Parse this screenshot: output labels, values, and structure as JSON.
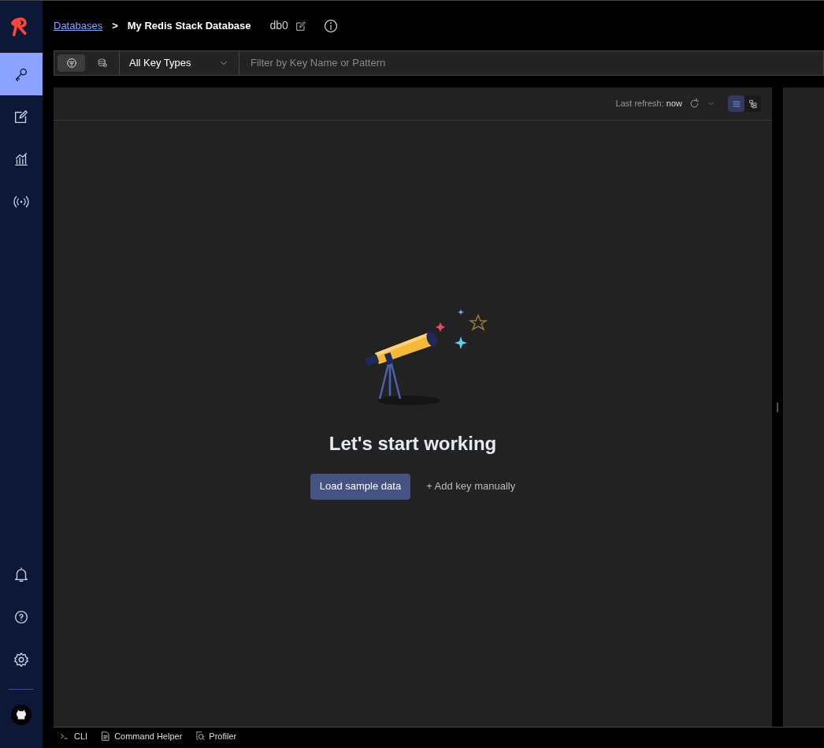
{
  "sidebar": {
    "nav_items": [
      {
        "kind": "key",
        "selected": true
      },
      {
        "kind": "edit",
        "selected": false
      },
      {
        "kind": "analytics",
        "selected": false
      },
      {
        "kind": "pubsub",
        "selected": false
      }
    ],
    "bottom_items": [
      {
        "kind": "bell"
      },
      {
        "kind": "help"
      },
      {
        "kind": "settings"
      },
      {
        "kind": "github"
      }
    ]
  },
  "breadcrumb": {
    "link": "Databases",
    "separator": ">",
    "current": "My Redis Stack Database",
    "db": "db0"
  },
  "filter_bar": {
    "modes": [
      {
        "kind": "filter",
        "selected": true
      },
      {
        "kind": "search",
        "selected": false
      }
    ],
    "key_type": "All Key Types",
    "search": {
      "placeholder": "Filter by Key Name or Pattern"
    }
  },
  "toolbar": {
    "last_refresh_label": "Last refresh:",
    "last_refresh_value": "now",
    "views": [
      {
        "kind": "list",
        "selected": true
      },
      {
        "kind": "tree",
        "selected": false
      }
    ]
  },
  "empty_state": {
    "title": "Let's start working",
    "primary_button": "Load sample data",
    "secondary_link": "+ Add key manually"
  },
  "bottom_bar": [
    {
      "kind": "cli",
      "label": "CLI"
    },
    {
      "kind": "helper",
      "label": "Command Helper"
    },
    {
      "kind": "profiler",
      "label": "Profiler"
    }
  ]
}
